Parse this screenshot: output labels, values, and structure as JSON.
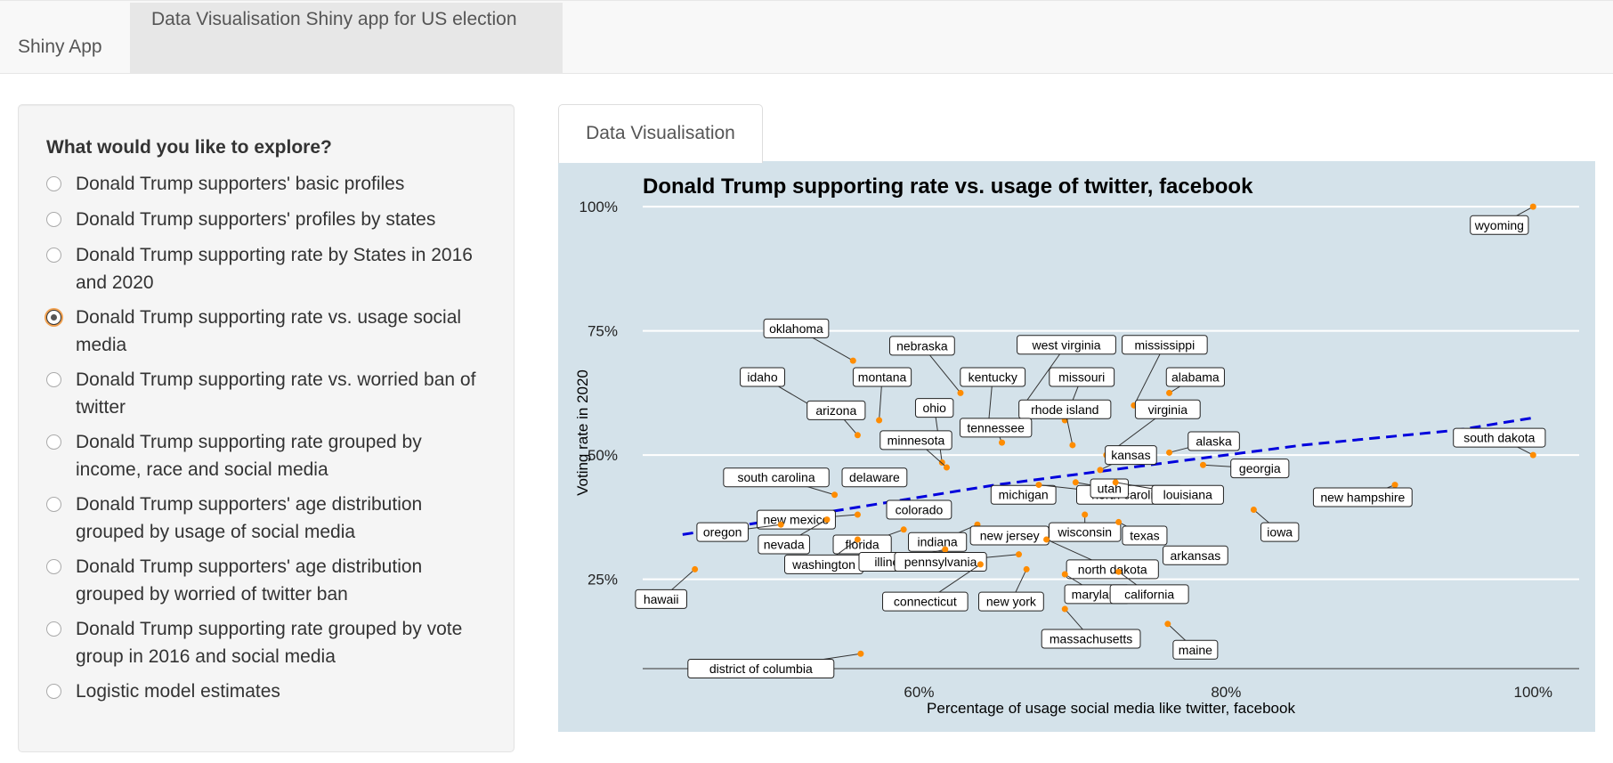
{
  "navbar": {
    "brand": "Shiny App",
    "tab": "Data Visualisation Shiny app for US election"
  },
  "sidebar": {
    "title": "What would you like to explore?",
    "options": [
      {
        "label": "Donald Trump supporters' basic profiles",
        "checked": false
      },
      {
        "label": "Donald Trump supporters' profiles by states",
        "checked": false
      },
      {
        "label": "Donald Trump supporting rate by States in 2016 and 2020",
        "checked": false
      },
      {
        "label": "Donald Trump supporting rate vs. usage social media",
        "checked": true
      },
      {
        "label": "Donald Trump supporting rate vs. worried ban of twitter",
        "checked": false
      },
      {
        "label": "Donald Trump supporting rate grouped by income, race and social media",
        "checked": false
      },
      {
        "label": "Donald Trump supporters' age distribution grouped by usage of social media",
        "checked": false
      },
      {
        "label": "Donald Trump supporters' age distribution grouped by worried of twitter ban",
        "checked": false
      },
      {
        "label": "Donald Trump supporting rate grouped by vote group in 2016 and social media",
        "checked": false
      },
      {
        "label": "Logistic model estimates",
        "checked": false
      }
    ]
  },
  "main": {
    "tab_label": "Data Visualisation"
  },
  "colors": {
    "panel_bg": "#d4e2ea",
    "point": "#ff8c00",
    "trend": "#0000dd"
  },
  "chart_data": {
    "type": "scatter",
    "title": "Donald Trump supporting rate vs. usage of twitter, facebook",
    "xlabel": "Percentage of usage social media like twitter, facebook",
    "ylabel": "Voting rate in 2020",
    "xlim": [
      0.42,
      1.03
    ],
    "ylim": [
      0.07,
      1.02
    ],
    "x_ticks": [
      {
        "value": 0.6,
        "label": "60%"
      },
      {
        "value": 0.8,
        "label": "80%"
      },
      {
        "value": 1.0,
        "label": "100%"
      }
    ],
    "y_ticks": [
      {
        "value": 0.25,
        "label": "25%"
      },
      {
        "value": 0.5,
        "label": "50%"
      },
      {
        "value": 0.75,
        "label": "75%"
      },
      {
        "value": 1.0,
        "label": "100%"
      }
    ],
    "grid": "horizontal",
    "trend_line": {
      "style": "dashed",
      "points": [
        [
          0.446,
          0.34
        ],
        [
          0.55,
          0.39
        ],
        [
          0.65,
          0.44
        ],
        [
          0.75,
          0.48
        ],
        [
          0.85,
          0.52
        ],
        [
          0.95,
          0.55
        ],
        [
          1.0,
          0.575
        ]
      ]
    },
    "points": [
      {
        "label": "wyoming",
        "x": 1.0,
        "y": 1.0,
        "lx": 0.978,
        "ly": 0.963
      },
      {
        "label": "oklahoma",
        "x": 0.557,
        "y": 0.69,
        "lx": 0.52,
        "ly": 0.755
      },
      {
        "label": "nebraska",
        "x": 0.627,
        "y": 0.625,
        "lx": 0.602,
        "ly": 0.72
      },
      {
        "label": "west virginia",
        "x": 0.668,
        "y": 0.6,
        "lx": 0.696,
        "ly": 0.722
      },
      {
        "label": "mississippi",
        "x": 0.74,
        "y": 0.6,
        "lx": 0.76,
        "ly": 0.722
      },
      {
        "label": "idaho",
        "x": 0.535,
        "y": 0.59,
        "lx": 0.498,
        "ly": 0.657
      },
      {
        "label": "montana",
        "x": 0.574,
        "y": 0.57,
        "lx": 0.576,
        "ly": 0.657
      },
      {
        "label": "kentucky",
        "x": 0.645,
        "y": 0.555,
        "lx": 0.648,
        "ly": 0.657
      },
      {
        "label": "missouri",
        "x": 0.695,
        "y": 0.57,
        "lx": 0.706,
        "ly": 0.657
      },
      {
        "label": "alabama",
        "x": 0.763,
        "y": 0.625,
        "lx": 0.78,
        "ly": 0.657
      },
      {
        "label": "ohio",
        "x": 0.615,
        "y": 0.485,
        "lx": 0.61,
        "ly": 0.595
      },
      {
        "label": "arizona",
        "x": 0.56,
        "y": 0.54,
        "lx": 0.546,
        "ly": 0.59
      },
      {
        "label": "rhode island",
        "x": 0.7,
        "y": 0.52,
        "lx": 0.695,
        "ly": 0.592
      },
      {
        "label": "virginia",
        "x": 0.722,
        "y": 0.5,
        "lx": 0.762,
        "ly": 0.592
      },
      {
        "label": "minnesota",
        "x": 0.618,
        "y": 0.475,
        "lx": 0.598,
        "ly": 0.53
      },
      {
        "label": "tennessee",
        "x": 0.654,
        "y": 0.525,
        "lx": 0.65,
        "ly": 0.555
      },
      {
        "label": "kansas",
        "x": 0.718,
        "y": 0.47,
        "lx": 0.738,
        "ly": 0.5
      },
      {
        "label": "alaska",
        "x": 0.763,
        "y": 0.505,
        "lx": 0.792,
        "ly": 0.528
      },
      {
        "label": "georgia",
        "x": 0.785,
        "y": 0.48,
        "lx": 0.822,
        "ly": 0.473
      },
      {
        "label": "south dakota",
        "x": 1.0,
        "y": 0.5,
        "lx": 0.978,
        "ly": 0.535
      },
      {
        "label": "south carolina",
        "x": 0.545,
        "y": 0.42,
        "lx": 0.507,
        "ly": 0.455
      },
      {
        "label": "delaware",
        "x": 0.58,
        "y": 0.45,
        "lx": 0.571,
        "ly": 0.455
      },
      {
        "label": "new mexico",
        "x": 0.56,
        "y": 0.38,
        "lx": 0.52,
        "ly": 0.37
      },
      {
        "label": "colorado",
        "x": 0.59,
        "y": 0.4,
        "lx": 0.6,
        "ly": 0.39
      },
      {
        "label": "michigan",
        "x": 0.665,
        "y": 0.43,
        "lx": 0.668,
        "ly": 0.42
      },
      {
        "label": "north carolina",
        "x": 0.678,
        "y": 0.44,
        "lx": 0.737,
        "ly": 0.42
      },
      {
        "label": "utah",
        "x": 0.702,
        "y": 0.445,
        "lx": 0.724,
        "ly": 0.433
      },
      {
        "label": "louisiana",
        "x": 0.728,
        "y": 0.445,
        "lx": 0.775,
        "ly": 0.42
      },
      {
        "label": "new hampshire",
        "x": 0.91,
        "y": 0.44,
        "lx": 0.889,
        "ly": 0.415
      },
      {
        "label": "oregon",
        "x": 0.51,
        "y": 0.36,
        "lx": 0.472,
        "ly": 0.345
      },
      {
        "label": "nevada",
        "x": 0.54,
        "y": 0.37,
        "lx": 0.512,
        "ly": 0.32
      },
      {
        "label": "florida",
        "x": 0.59,
        "y": 0.35,
        "lx": 0.563,
        "ly": 0.32
      },
      {
        "label": "indiana",
        "x": 0.638,
        "y": 0.36,
        "lx": 0.612,
        "ly": 0.325
      },
      {
        "label": "new jersey",
        "x": 0.665,
        "y": 0.35,
        "lx": 0.659,
        "ly": 0.338
      },
      {
        "label": "wisconsin",
        "x": 0.708,
        "y": 0.38,
        "lx": 0.708,
        "ly": 0.345
      },
      {
        "label": "texas",
        "x": 0.73,
        "y": 0.365,
        "lx": 0.747,
        "ly": 0.338
      },
      {
        "label": "iowa",
        "x": 0.818,
        "y": 0.39,
        "lx": 0.835,
        "ly": 0.345
      },
      {
        "label": "arkansas",
        "x": 0.777,
        "y": 0.29,
        "lx": 0.78,
        "ly": 0.298
      },
      {
        "label": "washington",
        "x": 0.56,
        "y": 0.33,
        "lx": 0.538,
        "ly": 0.28
      },
      {
        "label": "illinois",
        "x": 0.617,
        "y": 0.31,
        "lx": 0.582,
        "ly": 0.285
      },
      {
        "label": "pennsylvania",
        "x": 0.665,
        "y": 0.3,
        "lx": 0.614,
        "ly": 0.285
      },
      {
        "label": "north dakota",
        "x": 0.683,
        "y": 0.33,
        "lx": 0.726,
        "ly": 0.27
      },
      {
        "label": "hawaii",
        "x": 0.454,
        "y": 0.27,
        "lx": 0.432,
        "ly": 0.21
      },
      {
        "label": "connecticut",
        "x": 0.64,
        "y": 0.28,
        "lx": 0.604,
        "ly": 0.205
      },
      {
        "label": "new york",
        "x": 0.67,
        "y": 0.27,
        "lx": 0.66,
        "ly": 0.205
      },
      {
        "label": "maryland",
        "x": 0.695,
        "y": 0.26,
        "lx": 0.716,
        "ly": 0.22
      },
      {
        "label": "california",
        "x": 0.73,
        "y": 0.265,
        "lx": 0.75,
        "ly": 0.22
      },
      {
        "label": "massachusetts",
        "x": 0.695,
        "y": 0.19,
        "lx": 0.712,
        "ly": 0.13
      },
      {
        "label": "maine",
        "x": 0.762,
        "y": 0.16,
        "lx": 0.78,
        "ly": 0.108
      },
      {
        "label": "district of columbia",
        "x": 0.562,
        "y": 0.1,
        "lx": 0.497,
        "ly": 0.07
      }
    ]
  }
}
